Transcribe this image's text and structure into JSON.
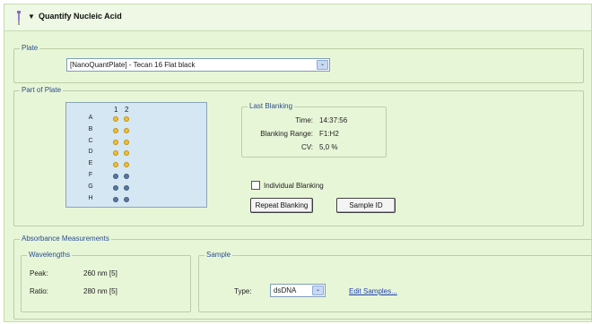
{
  "header": {
    "title": "Quantify Nucleic Acid",
    "pin_icon": "pin-icon",
    "collapse_icon": "triangle-down-icon"
  },
  "plate": {
    "group_label": "Plate",
    "selected": "[NanoQuantPlate] - Tecan 16 Flat black"
  },
  "part_of_plate": {
    "group_label": "Part of Plate",
    "columns": [
      "1",
      "2"
    ],
    "rows": [
      "A",
      "B",
      "C",
      "D",
      "E",
      "F",
      "G",
      "H"
    ],
    "sample_color": "#f2bf2a",
    "blank_color": "#58789c"
  },
  "last_blanking": {
    "group_label": "Last Blanking",
    "time_label": "Time:",
    "time_value": "14:37:56",
    "range_label": "Blanking Range:",
    "range_value": "F1:H2",
    "cv_label": "CV:",
    "cv_value": "5,0 %"
  },
  "individual_blanking": {
    "label": "Individual Blanking",
    "checked": false
  },
  "buttons": {
    "repeat_blanking": "Repeat Blanking",
    "sample_id": "Sample ID"
  },
  "absorbance": {
    "group_label": "Absorbance Measurements",
    "wavelengths": {
      "group_label": "Wavelengths",
      "peak_label": "Peak:",
      "peak_value": "260 nm [5]",
      "ratio_label": "Ratio:",
      "ratio_value": "280 nm [5]"
    },
    "sample": {
      "group_label": "Sample",
      "type_label": "Type:",
      "type_value": "dsDNA",
      "edit_link": "Edit Samples..."
    }
  }
}
